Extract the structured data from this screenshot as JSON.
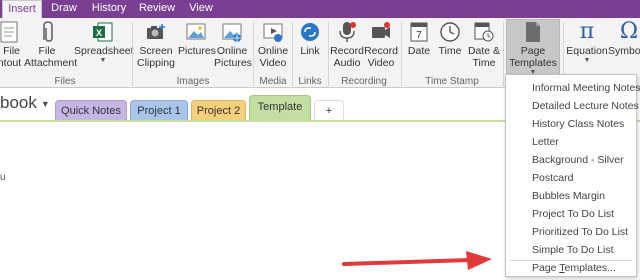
{
  "menu": {
    "tabs": [
      "Insert",
      "Draw",
      "History",
      "Review",
      "View"
    ],
    "active": "Insert"
  },
  "ribbon": {
    "buttons": {
      "file_printout": "File\nrintout",
      "file_attachment": "File\nAttachment",
      "spreadsheet": "Spreadsheet",
      "screen_clipping": "Screen\nClipping",
      "pictures": "Pictures",
      "online_pictures": "Online\nPictures",
      "online_video": "Online\nVideo",
      "link": "Link",
      "record_audio": "Record\nAudio",
      "record_video": "Record\nVideo",
      "date": "Date",
      "time": "Time",
      "date_time": "Date &\nTime",
      "page_templates": "Page\nTemplates",
      "equation": "Equation",
      "symbol": "Symbol"
    },
    "groups": {
      "files": "Files",
      "images": "Images",
      "media": "Media",
      "links": "Links",
      "recording": "Recording",
      "time_stamp": "Time Stamp"
    }
  },
  "notebook": {
    "title": "book",
    "sections": [
      {
        "label": "Quick Notes",
        "color": "#c5b6e6"
      },
      {
        "label": "Project 1",
        "color": "#a9c5ec"
      },
      {
        "label": "Project 2",
        "color": "#f5cf7a"
      },
      {
        "label": "Template",
        "color": "#c2dea1"
      },
      {
        "label": "+",
        "color": "#ffffff"
      }
    ]
  },
  "page": {
    "edge_glyph": "u"
  },
  "dropdown": {
    "items": [
      "Informal Meeting Notes",
      "Detailed Lecture Notes",
      "History Class Notes",
      "Letter",
      "Background - Silver",
      "Postcard",
      "Bubbles Margin",
      "Project To Do List",
      "Prioritized To Do List",
      "Simple To Do List"
    ],
    "footer": "Page Templates..."
  },
  "colors": {
    "accent": "#7a3f92",
    "arrow": "#e03a3a"
  }
}
